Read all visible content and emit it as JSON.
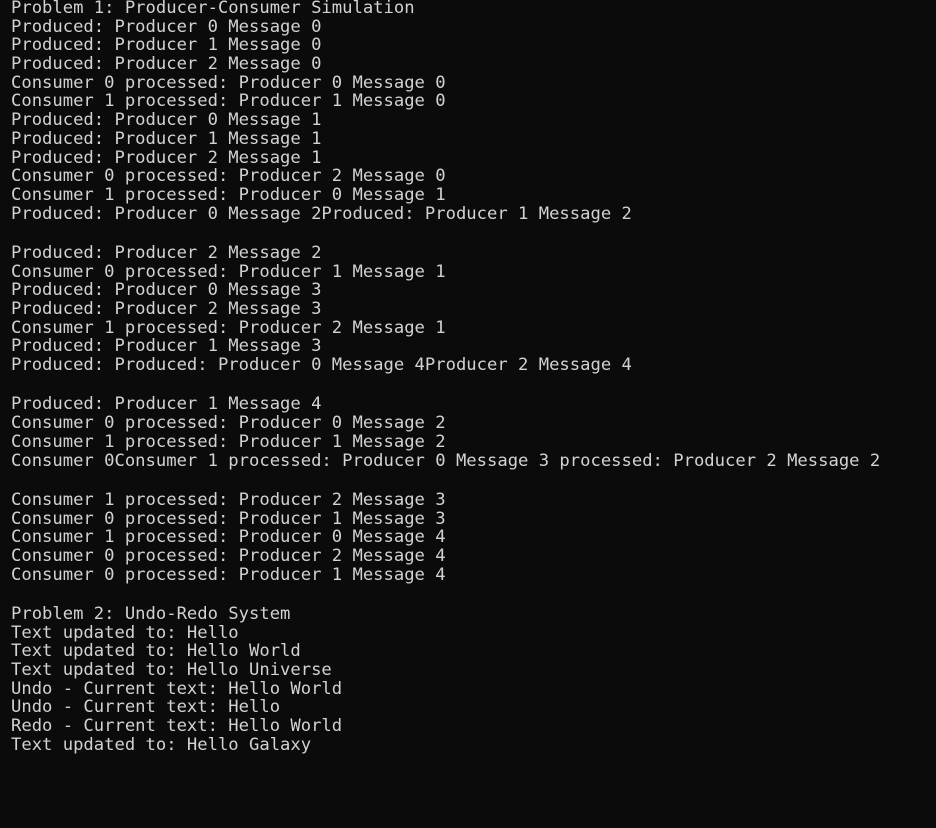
{
  "terminal": {
    "lines": [
      "Problem 1: Producer-Consumer Simulation",
      "Produced: Producer 0 Message 0",
      "Produced: Producer 1 Message 0",
      "Produced: Producer 2 Message 0",
      "Consumer 0 processed: Producer 0 Message 0",
      "Consumer 1 processed: Producer 1 Message 0",
      "Produced: Producer 0 Message 1",
      "Produced: Producer 1 Message 1",
      "Produced: Producer 2 Message 1",
      "Consumer 0 processed: Producer 2 Message 0",
      "Consumer 1 processed: Producer 0 Message 1",
      "Produced: Producer 0 Message 2Produced: Producer 1 Message 2",
      "",
      "Produced: Producer 2 Message 2",
      "Consumer 0 processed: Producer 1 Message 1",
      "Produced: Producer 0 Message 3",
      "Produced: Producer 2 Message 3",
      "Consumer 1 processed: Producer 2 Message 1",
      "Produced: Producer 1 Message 3",
      "Produced: Produced: Producer 0 Message 4Producer 2 Message 4",
      "",
      "Produced: Producer 1 Message 4",
      "Consumer 0 processed: Producer 0 Message 2",
      "Consumer 1 processed: Producer 1 Message 2",
      "Consumer 0Consumer 1 processed: Producer 0 Message 3 processed: Producer 2 Message 2",
      "",
      "Consumer 1 processed: Producer 2 Message 3",
      "Consumer 0 processed: Producer 1 Message 3",
      "Consumer 1 processed: Producer 0 Message 4",
      "Consumer 0 processed: Producer 2 Message 4",
      "Consumer 0 processed: Producer 1 Message 4",
      "",
      "Problem 2: Undo-Redo System",
      "Text updated to: Hello",
      "Text updated to: Hello World",
      "Text updated to: Hello Universe",
      "Undo - Current text: Hello World",
      "Undo - Current text: Hello",
      "Redo - Current text: Hello World",
      "Text updated to: Hello Galaxy"
    ]
  },
  "colors": {
    "background": "#0b0b0b",
    "foreground": "#d2d2d2"
  }
}
